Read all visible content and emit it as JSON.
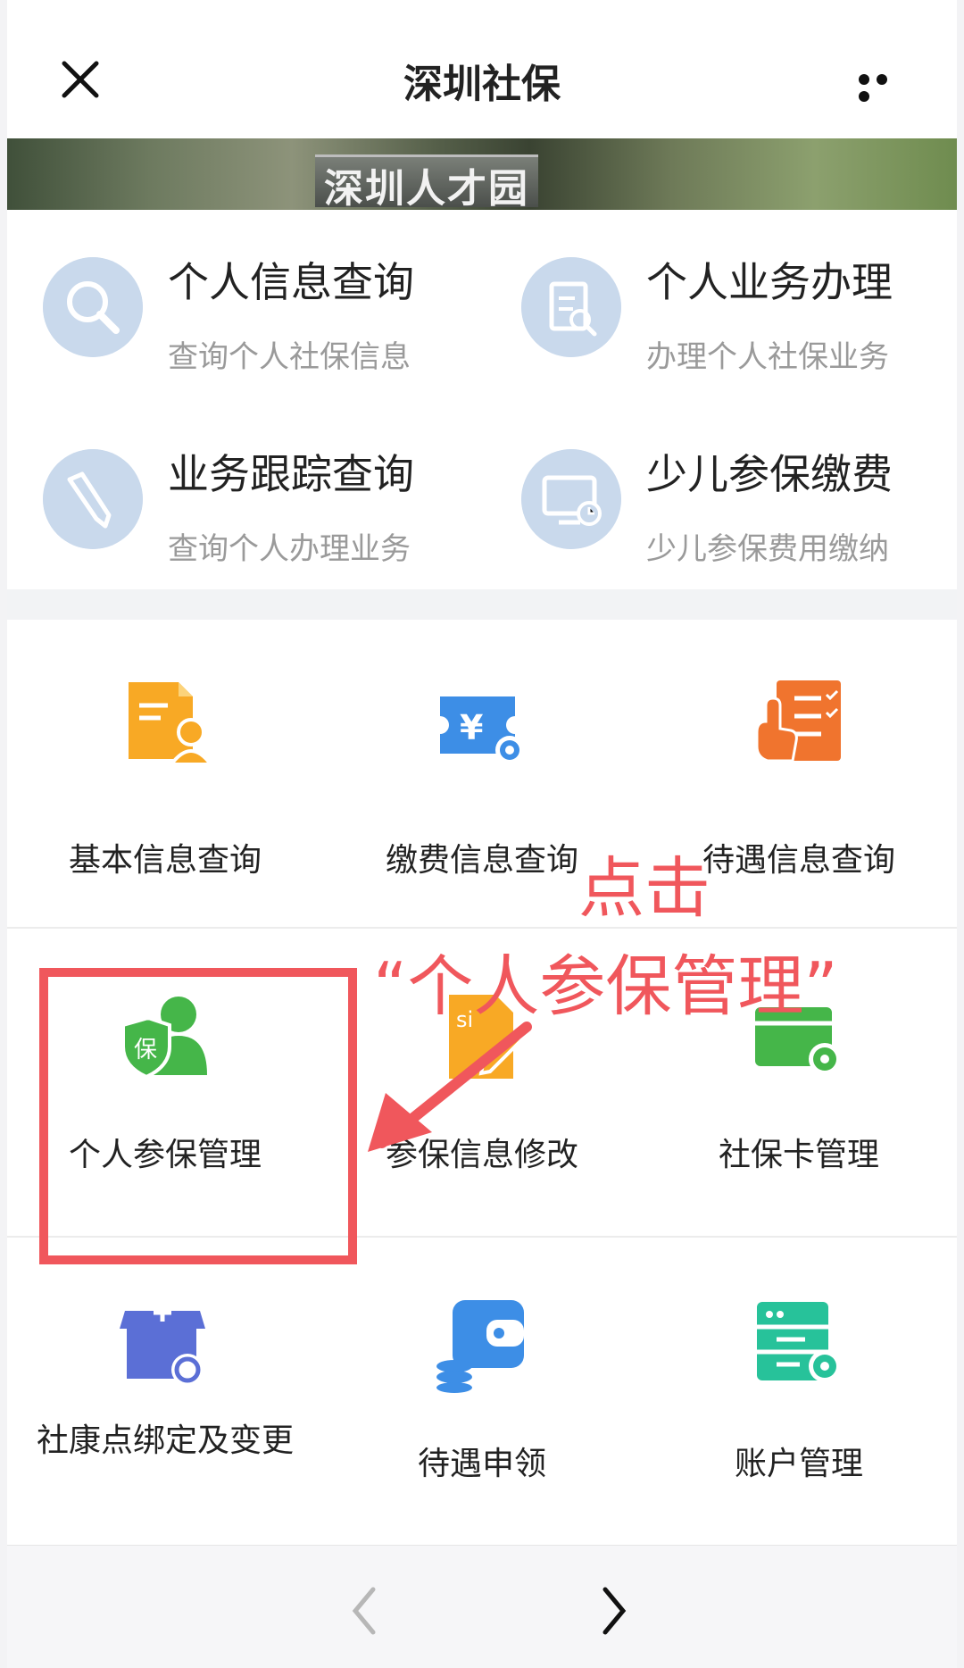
{
  "header": {
    "title": "深圳社保"
  },
  "banner": {
    "text": "深圳人才园"
  },
  "quick_services": [
    {
      "title": "个人信息查询",
      "subtitle": "查询个人社保信息",
      "icon": "search-icon"
    },
    {
      "title": "个人业务办理",
      "subtitle": "办理个人社保业务",
      "icon": "document-pen-icon"
    },
    {
      "title": "业务跟踪查询",
      "subtitle": "查询个人办理业务",
      "icon": "pencil-icon"
    },
    {
      "title": "少儿参保缴费",
      "subtitle": "少儿参保费用缴纳",
      "icon": "monitor-clock-icon"
    }
  ],
  "grid": [
    {
      "label": "基本信息查询",
      "icon": "profile-card-icon",
      "color": "#f8a925"
    },
    {
      "label": "缴费信息查询",
      "icon": "yuan-ticket-icon",
      "color": "#3d8ee6"
    },
    {
      "label": "待遇信息查询",
      "icon": "checklist-hand-icon",
      "color": "#f0742e"
    },
    {
      "label": "个人参保管理",
      "icon": "shield-user-icon",
      "color": "#45b649"
    },
    {
      "label": "参保信息修改",
      "icon": "si-document-icon",
      "color": "#f8a925"
    },
    {
      "label": "社保卡管理",
      "icon": "card-gear-icon",
      "color": "#45b649"
    },
    {
      "label": "社康点绑定及变更",
      "icon": "clinic-refresh-icon",
      "color": "#5b6fd6"
    },
    {
      "label": "待遇申领",
      "icon": "wallet-coins-icon",
      "color": "#3d8ee6"
    },
    {
      "label": "账户管理",
      "icon": "server-gear-icon",
      "color": "#27c29a"
    }
  ],
  "annotation": {
    "line1": "点击",
    "line2": "“个人参保管理”",
    "color": "#f0575c"
  }
}
